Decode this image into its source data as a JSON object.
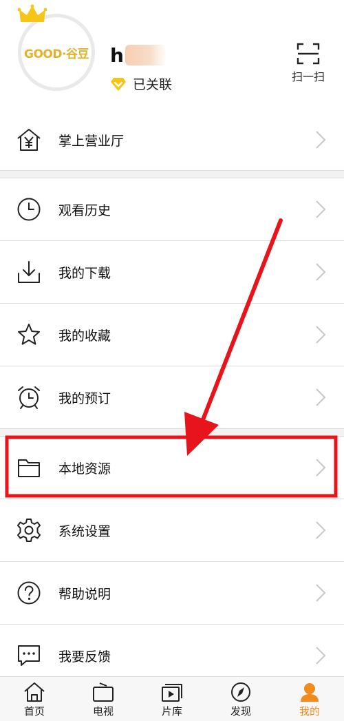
{
  "header": {
    "avatar_logo": "GOOD·谷豆",
    "username": "h",
    "linked_status": "已关联",
    "scan_label": "扫一扫"
  },
  "menu": {
    "business_hall": "掌上营业厅",
    "watch_history": "观看历史",
    "my_downloads": "我的下载",
    "my_favorites": "我的收藏",
    "my_reservations": "我的预订",
    "local_resources": "本地资源",
    "system_settings": "系统设置",
    "help": "帮助说明",
    "feedback": "我要反馈"
  },
  "tabbar": {
    "home": "首页",
    "tv": "电视",
    "library": "片库",
    "discover": "发现",
    "mine": "我的"
  },
  "colors": {
    "accent": "#f08c1e",
    "annotation": "#e8141c",
    "gold": "#e6b12a"
  },
  "icons": {
    "business_hall": "house-yen-icon",
    "watch_history": "clock-icon",
    "my_downloads": "download-icon",
    "my_favorites": "star-icon",
    "my_reservations": "alarm-clock-icon",
    "local_resources": "folder-icon",
    "system_settings": "gear-icon",
    "help": "question-icon",
    "feedback": "chat-bubble-icon"
  }
}
